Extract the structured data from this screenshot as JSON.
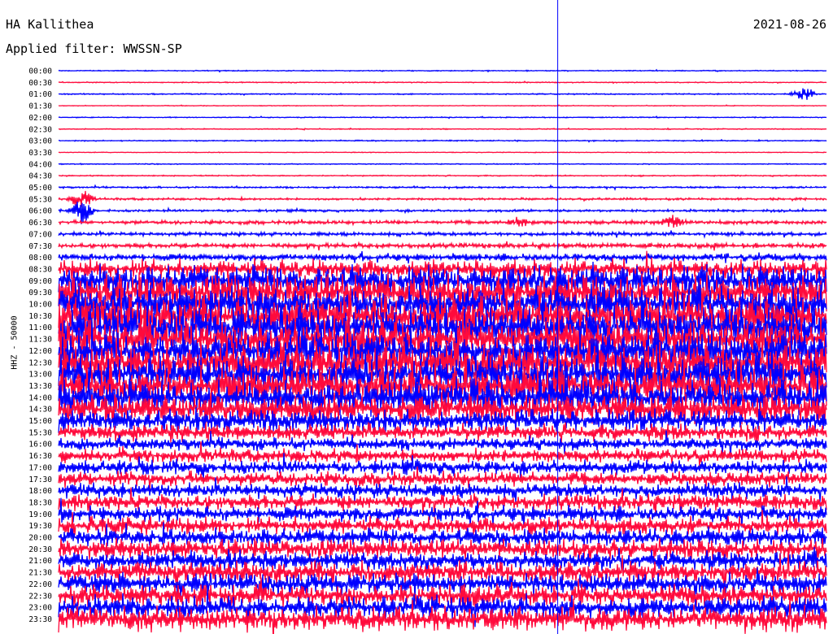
{
  "header": {
    "station": "HA Kallithea",
    "date": "2021-08-26",
    "filter": "Applied filter: WWSSN-SP"
  },
  "chart_data": {
    "type": "line",
    "title": "HA Kallithea",
    "ylabel": "HHZ - 50000",
    "row_labels": [
      "00:00",
      "00:30",
      "01:00",
      "01:30",
      "02:00",
      "02:30",
      "03:00",
      "03:30",
      "04:00",
      "04:30",
      "05:00",
      "05:30",
      "06:00",
      "06:30",
      "07:00",
      "07:30",
      "08:00",
      "08:30",
      "09:00",
      "09:30",
      "10:00",
      "10:30",
      "11:00",
      "11:30",
      "12:00",
      "12:30",
      "13:00",
      "13:30",
      "14:00",
      "14:30",
      "15:00",
      "15:30",
      "16:00",
      "16:30",
      "17:00",
      "17:30",
      "18:00",
      "18:30",
      "19:00",
      "19:30",
      "20:00",
      "20:30",
      "21:00",
      "21:30",
      "22:00",
      "22:30",
      "23:00",
      "23:30"
    ],
    "trace_colors": [
      "#0000ff",
      "#ff0a3c"
    ],
    "relative_amplitude": [
      0.08,
      0.08,
      0.1,
      0.06,
      0.08,
      0.08,
      0.1,
      0.06,
      0.08,
      0.1,
      0.14,
      0.18,
      0.2,
      0.3,
      0.3,
      0.4,
      0.6,
      1.6,
      2.6,
      3.0,
      3.2,
      3.2,
      3.3,
      3.3,
      3.3,
      3.3,
      3.2,
      3.2,
      3.0,
      2.6,
      1.8,
      1.4,
      1.0,
      1.1,
      1.2,
      1.2,
      1.2,
      1.3,
      1.3,
      1.4,
      1.5,
      1.6,
      1.6,
      1.7,
      1.7,
      1.8,
      1.9,
      2.0
    ],
    "events": [
      {
        "row": 2,
        "pos": 0.97,
        "strength": 1.2
      },
      {
        "row": 11,
        "pos": 0.03,
        "strength": 1.6
      },
      {
        "row": 12,
        "pos": 0.03,
        "strength": 2.2
      },
      {
        "row": 13,
        "pos": 0.6,
        "strength": 1.0
      },
      {
        "row": 13,
        "pos": 0.8,
        "strength": 1.0
      }
    ],
    "marker_time_fraction": 0.65
  }
}
